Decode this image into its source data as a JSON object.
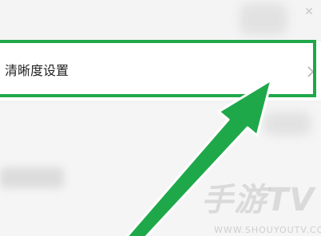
{
  "settings_row": {
    "label": "清晰度设置",
    "chevron_icon": "chevron-right-icon"
  },
  "annotation": {
    "color": "#1fa84a",
    "pointer": "arrow-pointing-to-row"
  },
  "watermark": {
    "brand": "手游TV",
    "url": "WWW.SHOUYOUTV.COM"
  }
}
